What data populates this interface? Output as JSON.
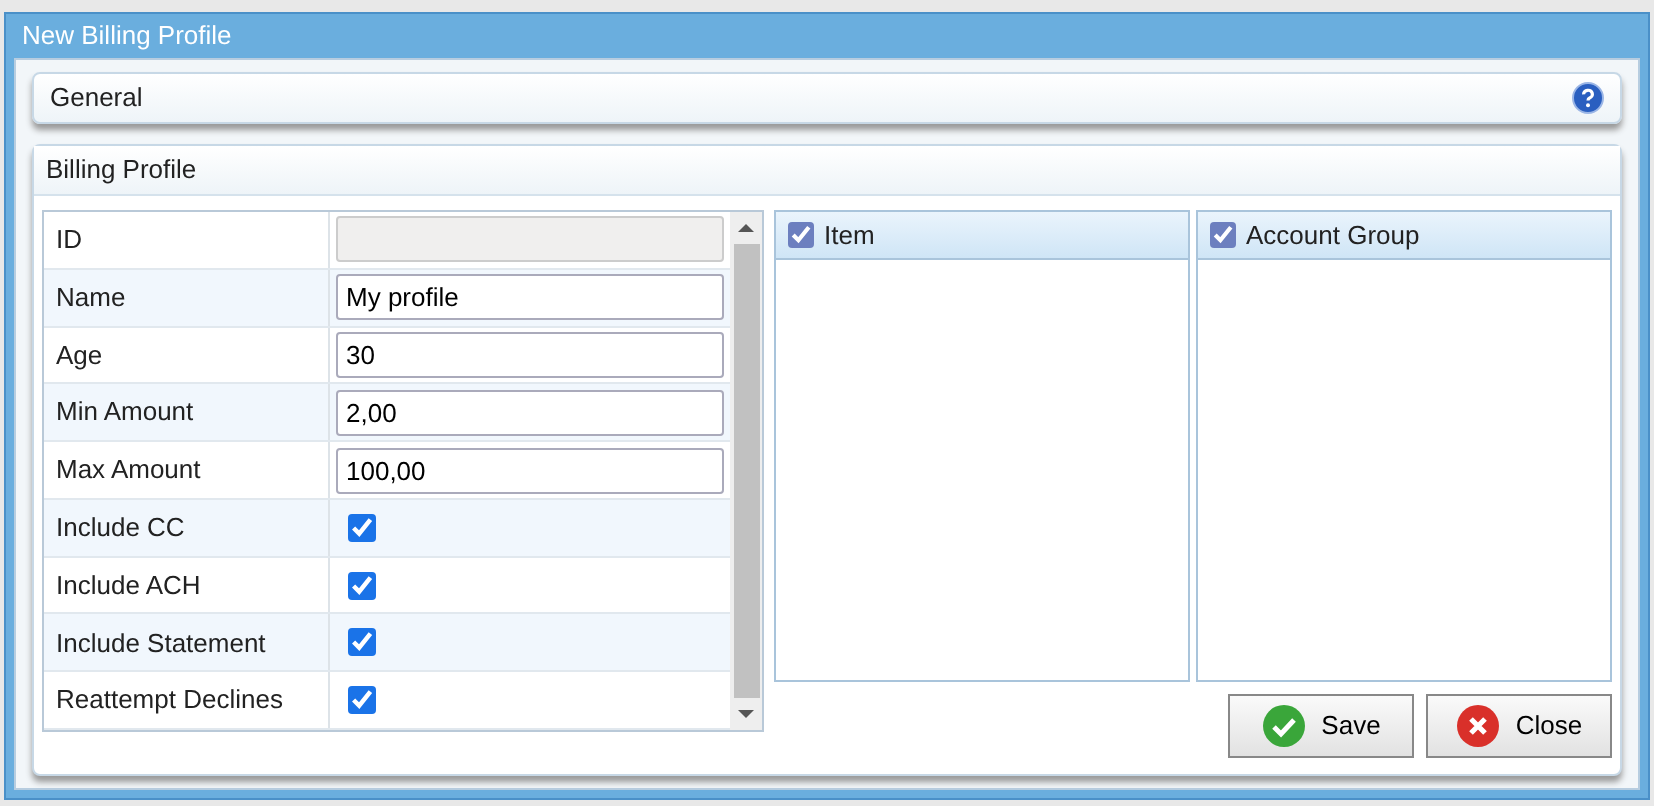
{
  "window": {
    "title": "New Billing Profile"
  },
  "general": {
    "title": "General"
  },
  "billing_profile": {
    "title": "Billing Profile",
    "fields": [
      {
        "label": "ID",
        "kind": "text",
        "disabled": true
      },
      {
        "label": "Name",
        "kind": "text",
        "value": "My profile",
        "disabled": false
      },
      {
        "label": "Age",
        "kind": "text",
        "value": "30",
        "disabled": false
      },
      {
        "label": "Min Amount",
        "kind": "text",
        "value": "2,00",
        "disabled": false
      },
      {
        "label": "Max Amount",
        "kind": "text",
        "value": "100,00",
        "disabled": false
      },
      {
        "label": "Include CC",
        "kind": "checkbox",
        "checked": true
      },
      {
        "label": "Include ACH",
        "kind": "checkbox",
        "checked": true
      },
      {
        "label": "Include Statement",
        "kind": "checkbox",
        "checked": true
      },
      {
        "label": "Reattempt Declines",
        "kind": "checkbox",
        "checked": true
      }
    ],
    "lists": [
      {
        "header": "Item",
        "checked": true
      },
      {
        "header": "Account Group",
        "checked": true
      }
    ]
  },
  "buttons": [
    {
      "label": "Save",
      "kind": "save"
    },
    {
      "label": "Close",
      "kind": "close"
    }
  ]
}
